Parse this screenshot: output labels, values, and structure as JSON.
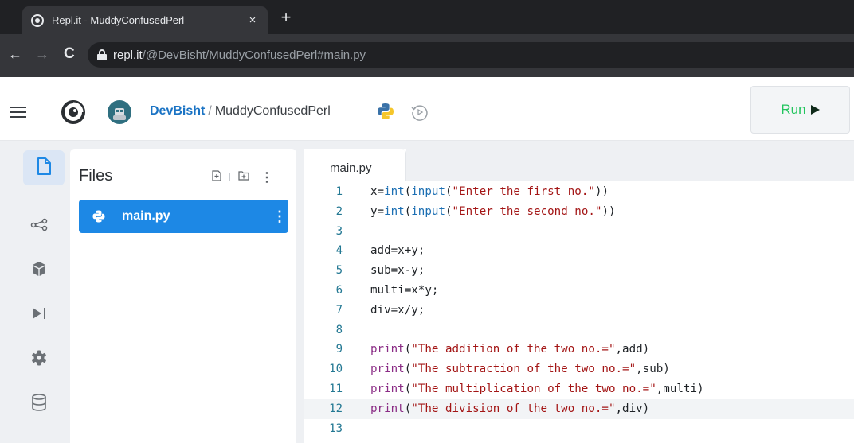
{
  "browser": {
    "tab_title": "Repl.it - MuddyConfusedPerl",
    "tab_close": "×",
    "new_tab": "+",
    "url_host": "repl.it",
    "url_path": "/@DevBisht/MuddyConfusedPerl#main.py"
  },
  "header": {
    "user": "DevBisht",
    "separator": "/",
    "repl_name": "MuddyConfusedPerl",
    "run_label": "Run"
  },
  "files_panel": {
    "title": "Files",
    "files": [
      {
        "name": "main.py",
        "menu": "⋮"
      }
    ],
    "menu": "⋮"
  },
  "editor": {
    "tab_label": "main.py",
    "current_line": 12,
    "lines": [
      {
        "n": "1",
        "tokens": [
          [
            "t",
            "x="
          ],
          [
            "fn",
            "int"
          ],
          [
            "t",
            "("
          ],
          [
            "fn",
            "input"
          ],
          [
            "t",
            "("
          ],
          [
            "st",
            "\"Enter the first no.\""
          ],
          [
            "t",
            "))"
          ]
        ]
      },
      {
        "n": "2",
        "tokens": [
          [
            "t",
            "y="
          ],
          [
            "fn",
            "int"
          ],
          [
            "t",
            "("
          ],
          [
            "fn",
            "input"
          ],
          [
            "t",
            "("
          ],
          [
            "st",
            "\"Enter the second no.\""
          ],
          [
            "t",
            "))"
          ]
        ]
      },
      {
        "n": "3",
        "tokens": []
      },
      {
        "n": "4",
        "tokens": [
          [
            "t",
            "add=x+y;"
          ]
        ]
      },
      {
        "n": "5",
        "tokens": [
          [
            "t",
            "sub=x-y;"
          ]
        ]
      },
      {
        "n": "6",
        "tokens": [
          [
            "t",
            "multi=x*y;"
          ]
        ]
      },
      {
        "n": "7",
        "tokens": [
          [
            "t",
            "div=x/y;"
          ]
        ]
      },
      {
        "n": "8",
        "tokens": []
      },
      {
        "n": "9",
        "tokens": [
          [
            "kw",
            "print"
          ],
          [
            "t",
            "("
          ],
          [
            "st",
            "\"The addition of the two no.=\""
          ],
          [
            "t",
            ",add)"
          ]
        ]
      },
      {
        "n": "10",
        "tokens": [
          [
            "kw",
            "print"
          ],
          [
            "t",
            "("
          ],
          [
            "st",
            "\"The subtraction of the two no.=\""
          ],
          [
            "t",
            ",sub)"
          ]
        ]
      },
      {
        "n": "11",
        "tokens": [
          [
            "kw",
            "print"
          ],
          [
            "t",
            "("
          ],
          [
            "st",
            "\"The multiplication of the two no.=\""
          ],
          [
            "t",
            ",multi)"
          ]
        ]
      },
      {
        "n": "12",
        "tokens": [
          [
            "kw",
            "print"
          ],
          [
            "t",
            "("
          ],
          [
            "st",
            "\"The division of the two no.=\""
          ],
          [
            "t",
            ",div)"
          ]
        ]
      },
      {
        "n": "13",
        "tokens": []
      }
    ]
  },
  "sidebar_rail": {
    "items": [
      {
        "icon": "files-icon",
        "active": true
      },
      {
        "icon": "share-icon",
        "active": false
      },
      {
        "icon": "packages-icon",
        "active": false
      },
      {
        "icon": "debugger-icon",
        "active": false
      },
      {
        "icon": "settings-icon",
        "active": false
      },
      {
        "icon": "database-icon",
        "active": false
      }
    ]
  },
  "colors": {
    "accent": "#1d88e5",
    "run_green": "#22c55e",
    "user_link": "#1a73c4"
  }
}
